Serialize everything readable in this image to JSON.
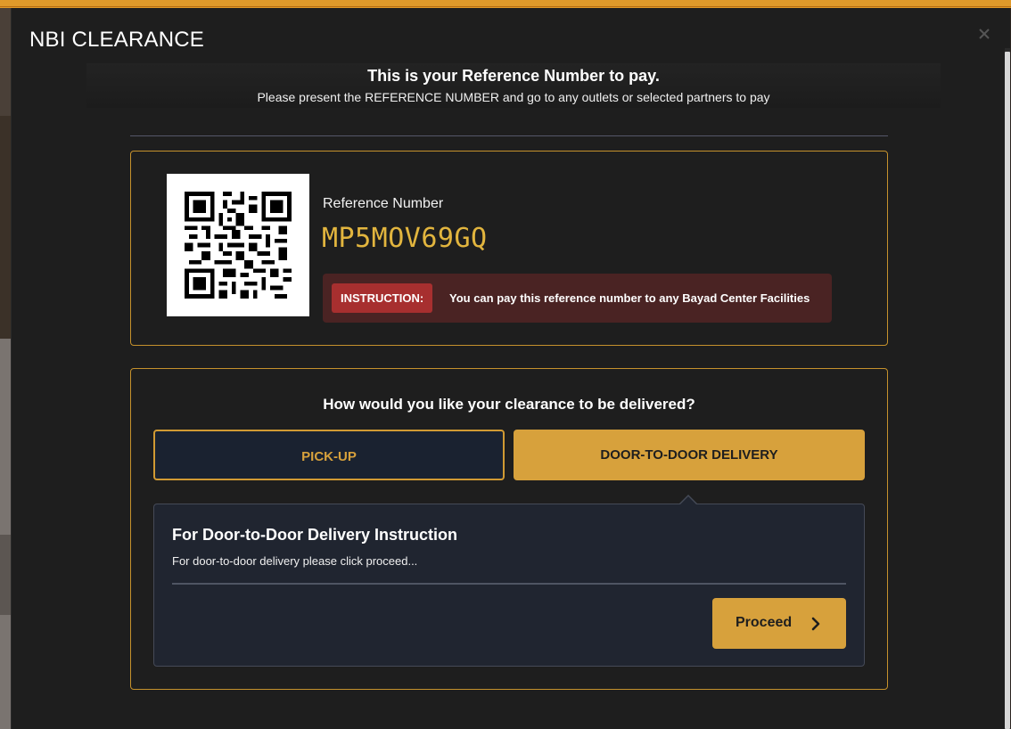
{
  "modal": {
    "title": "NBI CLEARANCE"
  },
  "reference_header": {
    "heading": "This is your Reference Number to pay.",
    "subtext": "Please present the REFERENCE NUMBER and go to any outlets or selected partners to pay"
  },
  "reference_card": {
    "label": "Reference Number",
    "number": "MP5MOV69GQ",
    "instruction_badge": "INSTRUCTION:",
    "instruction_text": "You can pay this reference number to any Bayad Center Facilities"
  },
  "delivery": {
    "question": "How would you like your clearance to be delivered?",
    "options": [
      {
        "label": "PICK-UP",
        "selected": false
      },
      {
        "label": "DOOR-TO-DOOR DELIVERY",
        "selected": true
      }
    ],
    "panel_title": "For Door-to-Door Delivery Instruction",
    "panel_text": "For door-to-door delivery please click proceed...",
    "proceed_label": "Proceed"
  },
  "colors": {
    "accent": "#d7a13c",
    "reference_number": "#e2b53e",
    "instruction_bg": "#4a2323",
    "instruction_badge": "#a72f2f",
    "modal_bg": "#1e1e1e"
  },
  "icons": [
    "close-icon",
    "qr-code-icon",
    "chevron-right-icon"
  ]
}
